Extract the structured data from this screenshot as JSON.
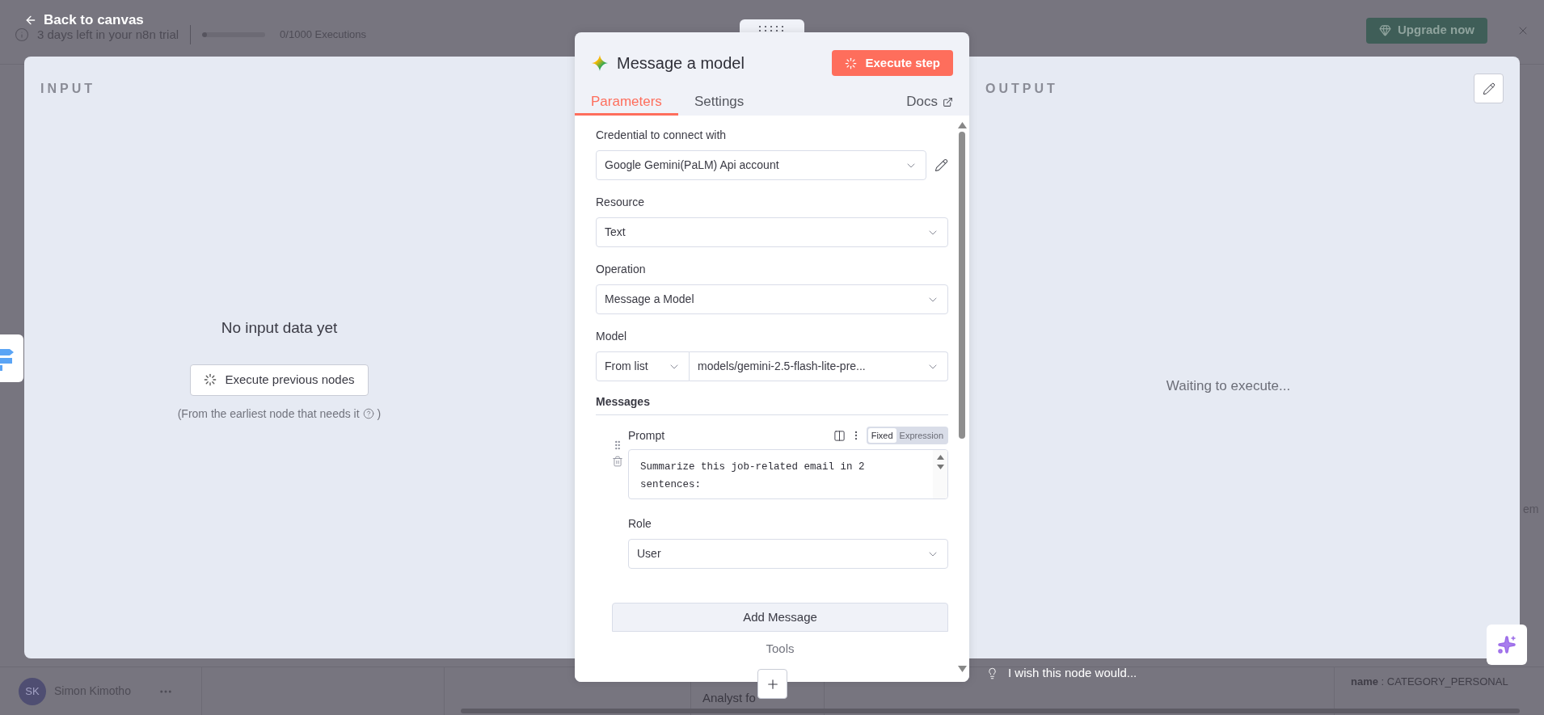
{
  "background": {
    "trial": {
      "text": "3 days left in your n8n trial",
      "executions": "0/1000 Executions",
      "level": 0.05
    },
    "upgrade_button": "Upgrade now",
    "user": {
      "initials": "SK",
      "name": "Simon Kimotho"
    },
    "canvas_text": "Analyst fo",
    "canvas_side_text": "em",
    "canvas_pair": {
      "key": "name",
      "separator": ":",
      "value": "CATEGORY_PERSONAL"
    }
  },
  "back_link": "Back to canvas",
  "input_panel": {
    "title": "INPUT",
    "empty_title": "No input data yet",
    "button": "Execute previous nodes",
    "hint_open": "(From the earliest node that needs it",
    "hint_close": ")"
  },
  "output_panel": {
    "title": "OUTPUT",
    "message": "Waiting to execute..."
  },
  "node": {
    "title": "Message a model",
    "execute_button": "Execute step",
    "tabs": [
      {
        "label": "Parameters",
        "selected": true
      },
      {
        "label": "Settings",
        "selected": false
      }
    ],
    "docs_link": "Docs",
    "fields": [
      {
        "kind": "credential",
        "label": "Credential to connect with",
        "value": "Google Gemini(PaLM) Api account"
      },
      {
        "kind": "select",
        "label": "Resource",
        "value": "Text"
      },
      {
        "kind": "select",
        "label": "Operation",
        "value": "Message a Model"
      },
      {
        "kind": "model",
        "label": "Model",
        "mode": "From list",
        "value": "models/gemini-2.5-flash-lite-pre..."
      }
    ],
    "messages": {
      "title": "Messages",
      "prompt_label": "Prompt",
      "modes": [
        {
          "label": "Fixed",
          "selected": true
        },
        {
          "label": "Expression",
          "selected": false
        }
      ],
      "prompt_lines": [
        "Summarize this job-related email in 2",
        "sentences:"
      ],
      "role_label": "Role",
      "role_value": "User"
    },
    "add_button": "Add Message",
    "tools_label": "Tools"
  },
  "wish_text": "I wish this node would..."
}
